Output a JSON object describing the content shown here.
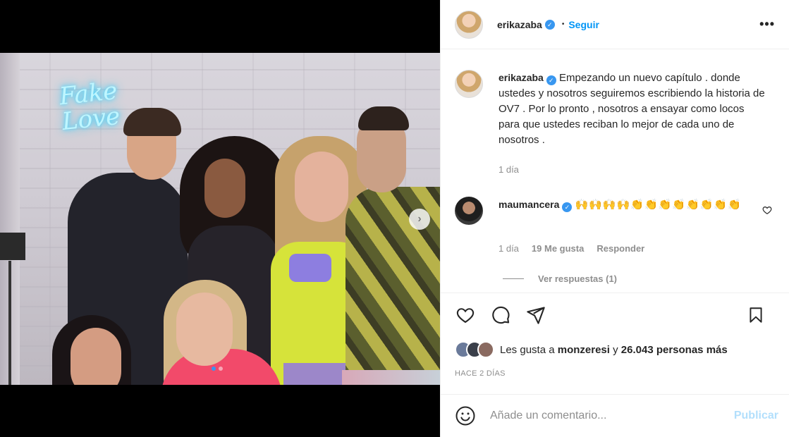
{
  "post": {
    "author": "erikazaba",
    "follow_label": "Seguir",
    "bullet": "•",
    "more_label": "•••",
    "verified_mark": "✓"
  },
  "media": {
    "neon_sign": "Fake\nLove",
    "next_label": "›",
    "slide_count": 2,
    "active_slide": 1
  },
  "caption": {
    "author": "erikazaba",
    "text": "Empezando un nuevo capítulo . donde ustedes y nosotros seguiremos escribiendo la historia de OV7 . Por lo pronto , nosotros a ensayar como locos para que ustedes reciban lo mejor de cada uno de nosotros .",
    "time": "1 día"
  },
  "comment": {
    "author": "maumancera",
    "emojis": "🙌🙌🙌🙌👏👏👏👏👏👏👏👏",
    "time": "1 día",
    "likes": "19 Me gusta",
    "reply_label": "Responder",
    "view_replies": "Ver respuestas (1)"
  },
  "likes": {
    "prefix": "Les gusta a",
    "user": "monzeresi",
    "connector": "y",
    "count": "26.043 personas más"
  },
  "date": "HACE 2 DÍAS",
  "add_comment": {
    "placeholder": "Añade un comentario...",
    "publish_label": "Publicar"
  },
  "colors": {
    "accent": "#0095f6",
    "verified": "#3897f0",
    "muted": "#8e8e8e",
    "publish_disabled": "#b2dffc"
  },
  "icons": [
    "heart-icon",
    "comment-icon",
    "share-icon",
    "bookmark-icon",
    "smile-icon",
    "more-icon",
    "next-arrow-icon",
    "verified-icon"
  ]
}
